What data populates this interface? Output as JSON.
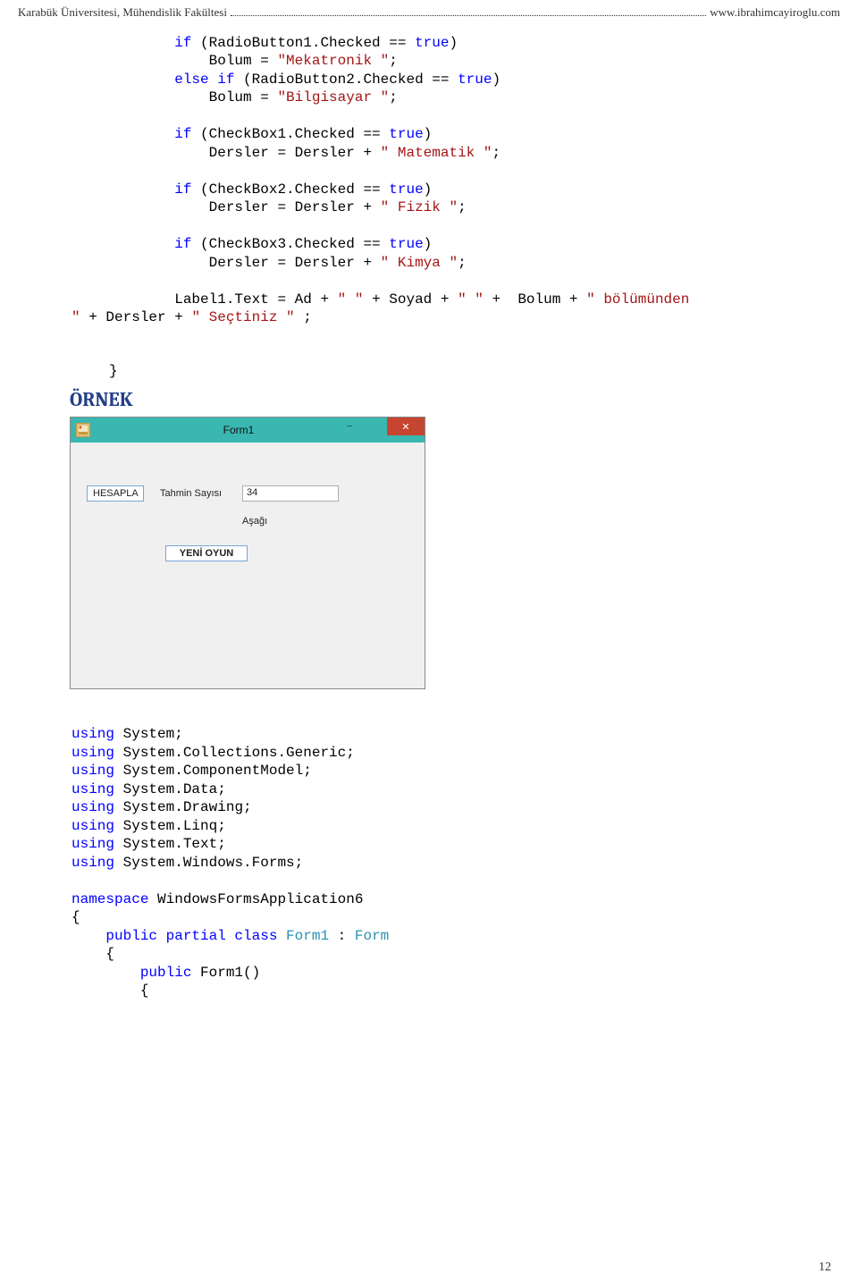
{
  "header": {
    "left": "Karabük Üniversitesi, Mühendislik Fakültesi",
    "right": "www.ibrahimcayiroglu.com"
  },
  "code1": {
    "l1a": "            if",
    "l1b": " (RadioButton1.Checked == ",
    "l1c": "true",
    "l1d": ")",
    "l2a": "                Bolum = ",
    "l2b": "\"Mekatronik \"",
    "l2c": ";",
    "l3a": "            else if",
    "l3b": " (RadioButton2.Checked == ",
    "l3c": "true",
    "l3d": ")",
    "l4a": "                Bolum = ",
    "l4b": "\"Bilgisayar \"",
    "l4c": ";",
    "l5a": "            if",
    "l5b": " (CheckBox1.Checked == ",
    "l5c": "true",
    "l5d": ")",
    "l6a": "                Dersler = Dersler + ",
    "l6b": "\" Matematik \"",
    "l6c": ";",
    "l7a": "            if",
    "l7b": " (CheckBox2.Checked == ",
    "l7c": "true",
    "l7d": ")",
    "l8a": "                Dersler = Dersler + ",
    "l8b": "\" Fizik \"",
    "l8c": ";",
    "l9a": "            if",
    "l9b": " (CheckBox3.Checked == ",
    "l9c": "true",
    "l9d": ")",
    "l10a": "                Dersler = Dersler + ",
    "l10b": "\" Kimya \"",
    "l10c": ";",
    "l11a": "            Label1.Text = Ad + ",
    "l11b": "\" \"",
    "l11c": " + Soyad + ",
    "l11d": "\" \"",
    "l11e": " +  Bolum + ",
    "l11f": "\" bölümünden",
    "l12a": "\"",
    "l12b": " + Dersler + ",
    "l12c": "\" Seçtiniz \"",
    "l12d": " ;"
  },
  "closebrace": "        }",
  "ornek_title": "ÖRNEK",
  "form": {
    "title": "Form1",
    "hesapla": "HESAPLA",
    "tahmin_label": "Tahmin Sayısı",
    "tahmin_value": "34",
    "asagi": "Aşağı",
    "yeni_oyun": "YENİ OYUN"
  },
  "code2": {
    "u": "using",
    "ns": " System;",
    "ns2": " System.Collections.Generic;",
    "ns3": " System.ComponentModel;",
    "ns4": " System.Data;",
    "ns5": " System.Drawing;",
    "ns6": " System.Linq;",
    "ns7": " System.Text;",
    "ns8": " System.Windows.Forms;",
    "nsk": "namespace",
    "nsn": " WindowsFormsApplication6",
    "ob": "{",
    "pub": "    public partial class ",
    "f1": "Form1",
    "colon": " : ",
    "frm": "Form",
    "ob2": "    {",
    "pub2": "        public",
    "ctor": " Form1()",
    "ob3": "        {"
  },
  "page_number": "12"
}
